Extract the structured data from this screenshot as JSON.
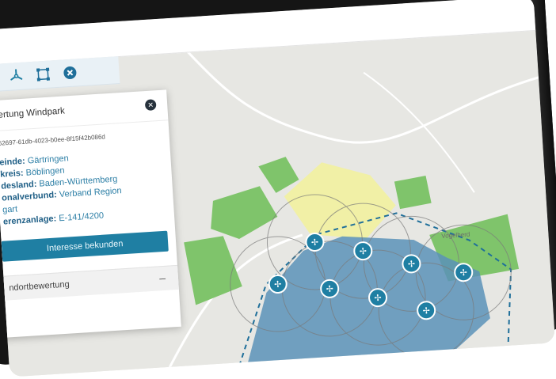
{
  "toolbar": {
    "icons": [
      "wind-turbine-icon",
      "polygon-select-icon",
      "close-icon"
    ]
  },
  "panel": {
    "title": "ertung Windpark",
    "uuid": "52697-61db-4023-b0ee-8f15f42b086d",
    "fields": [
      {
        "label": "einde:",
        "value": " Gärtringen"
      },
      {
        "label": "kreis:",
        "value": " Böblingen"
      },
      {
        "label": "desland:",
        "value": " Baden-Württemberg"
      },
      {
        "label": "onalverbund:",
        "value": " Verband Region"
      },
      {
        "label": "",
        "value": "gart"
      },
      {
        "label": "erenzanlage:",
        "value": " E-141/4200"
      }
    ],
    "interest_button": "Interesse bekunden",
    "section_label": "ndortbewertung",
    "section_toggle": "–"
  },
  "map": {
    "place_label": "Vogelherd",
    "turbine_icon": "wind-turbine-icon",
    "colors": {
      "accent": "#1f7fa3",
      "zone_blue": "#5b92b9",
      "zone_green": "#7fc46b",
      "zone_yellow": "#f1f0a6",
      "background": "#e7e7e3"
    }
  }
}
